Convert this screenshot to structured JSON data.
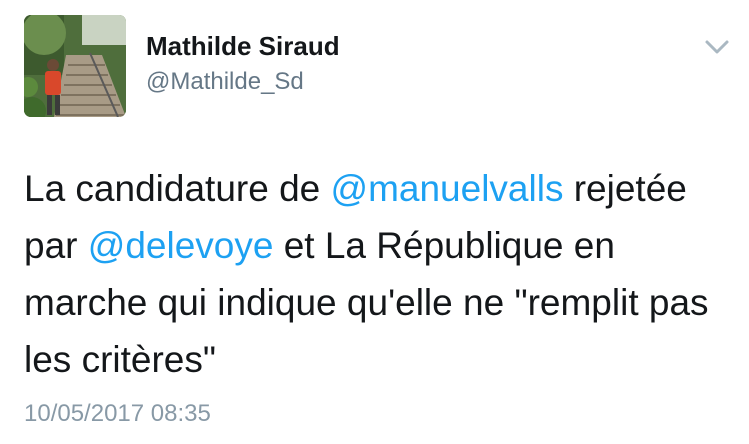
{
  "tweet": {
    "author": {
      "name": "Mathilde Siraud",
      "handle": "@Mathilde_Sd"
    },
    "text": {
      "part1": "La candidature de ",
      "mention1": "@manuelvalls",
      "part2": " rejetée par ",
      "mention2": "@delevoye",
      "part3": " et La République en marche qui indique qu'elle ne \"remplit pas les critères\""
    },
    "timestamp": "10/05/2017 08:35",
    "menu_icon": "chevron-down-icon"
  },
  "colors": {
    "text": "#14171a",
    "handle": "#657786",
    "mention": "#1da1f2",
    "timestamp": "#8899a6",
    "caret": "#aab8c2"
  }
}
